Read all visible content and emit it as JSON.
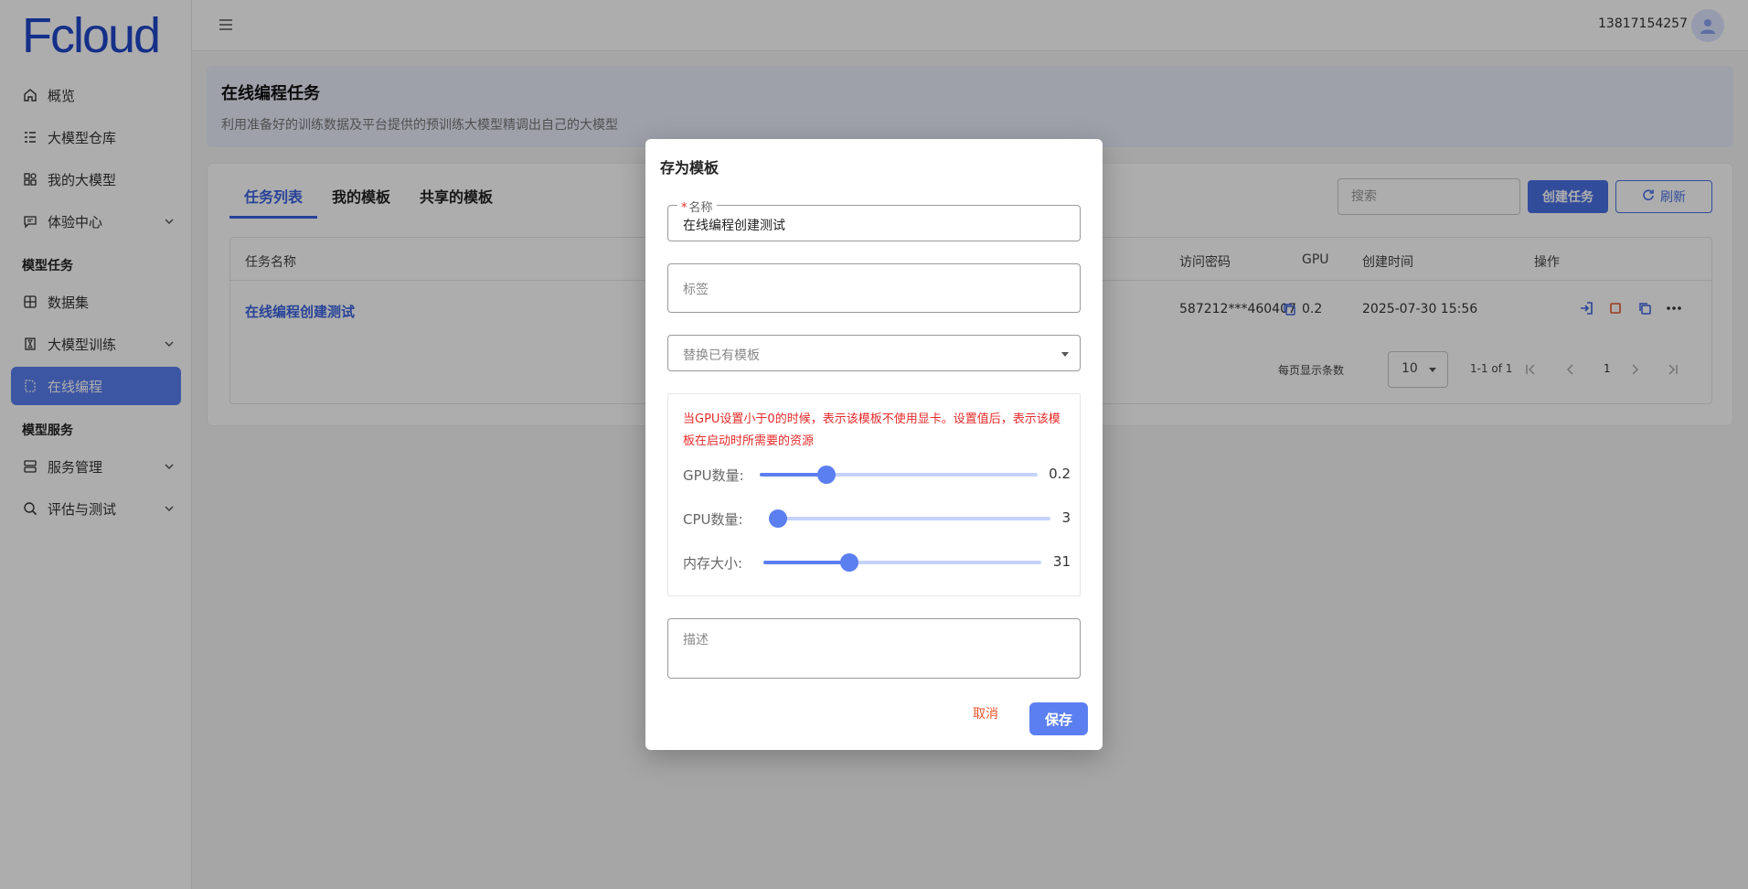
{
  "app": {
    "logo_text": "Fcloud"
  },
  "header": {
    "user_phone": "13817154257"
  },
  "sidebar": {
    "items": [
      {
        "label": "概览"
      },
      {
        "label": "大模型仓库"
      },
      {
        "label": "我的大模型"
      },
      {
        "label": "体验中心"
      }
    ],
    "section_tasks": "模型任务",
    "task_items": [
      {
        "label": "数据集"
      },
      {
        "label": "大模型训练"
      },
      {
        "label": "在线编程"
      }
    ],
    "section_services": "模型服务",
    "service_items": [
      {
        "label": "服务管理"
      },
      {
        "label": "评估与测试"
      }
    ]
  },
  "page": {
    "title": "在线编程任务",
    "subtitle": "利用准备好的训练数据及平台提供的预训练大模型精调出自己的大模型"
  },
  "tabs": [
    {
      "label": "任务列表"
    },
    {
      "label": "我的模板"
    },
    {
      "label": "共享的模板"
    }
  ],
  "toolbar": {
    "search_placeholder": "搜索",
    "create_label": "创建任务",
    "refresh_label": "刷新"
  },
  "table": {
    "headers": [
      "任务名称",
      "访问密码",
      "GPU",
      "创建时间",
      "操作"
    ],
    "rows": [
      {
        "name": "在线编程创建测试",
        "password": "587212***460407",
        "gpu": "0.2",
        "created": "2025-07-30 15:56"
      }
    ]
  },
  "pagination": {
    "rows_per_page_label": "每页显示条数",
    "rows_per_page": "10",
    "range": "1-1 of 1",
    "page": "1"
  },
  "modal": {
    "title": "存为模板",
    "name_label": "名称",
    "name_value": "在线编程创建测试",
    "tag_placeholder": "标签",
    "replace_placeholder": "替换已有模板",
    "note": "当GPU设置小于0的时候，表示该模板不使用显卡。设置值后，表示该模板在启动时所需要的资源",
    "sliders": [
      {
        "label": "GPU数量:",
        "value": "0.2",
        "fraction": 0.24
      },
      {
        "label": "CPU数量:",
        "value": "3",
        "fraction": 0.0
      },
      {
        "label": "内存大小:",
        "value": "31",
        "fraction": 0.31
      }
    ],
    "desc_placeholder": "描述",
    "cancel_label": "取消",
    "save_label": "保存"
  },
  "colors": {
    "accent": "#5b7ff0",
    "primary": "#4a70e6",
    "warning_text": "#e52a2a",
    "cancel_text": "#e8562a"
  }
}
